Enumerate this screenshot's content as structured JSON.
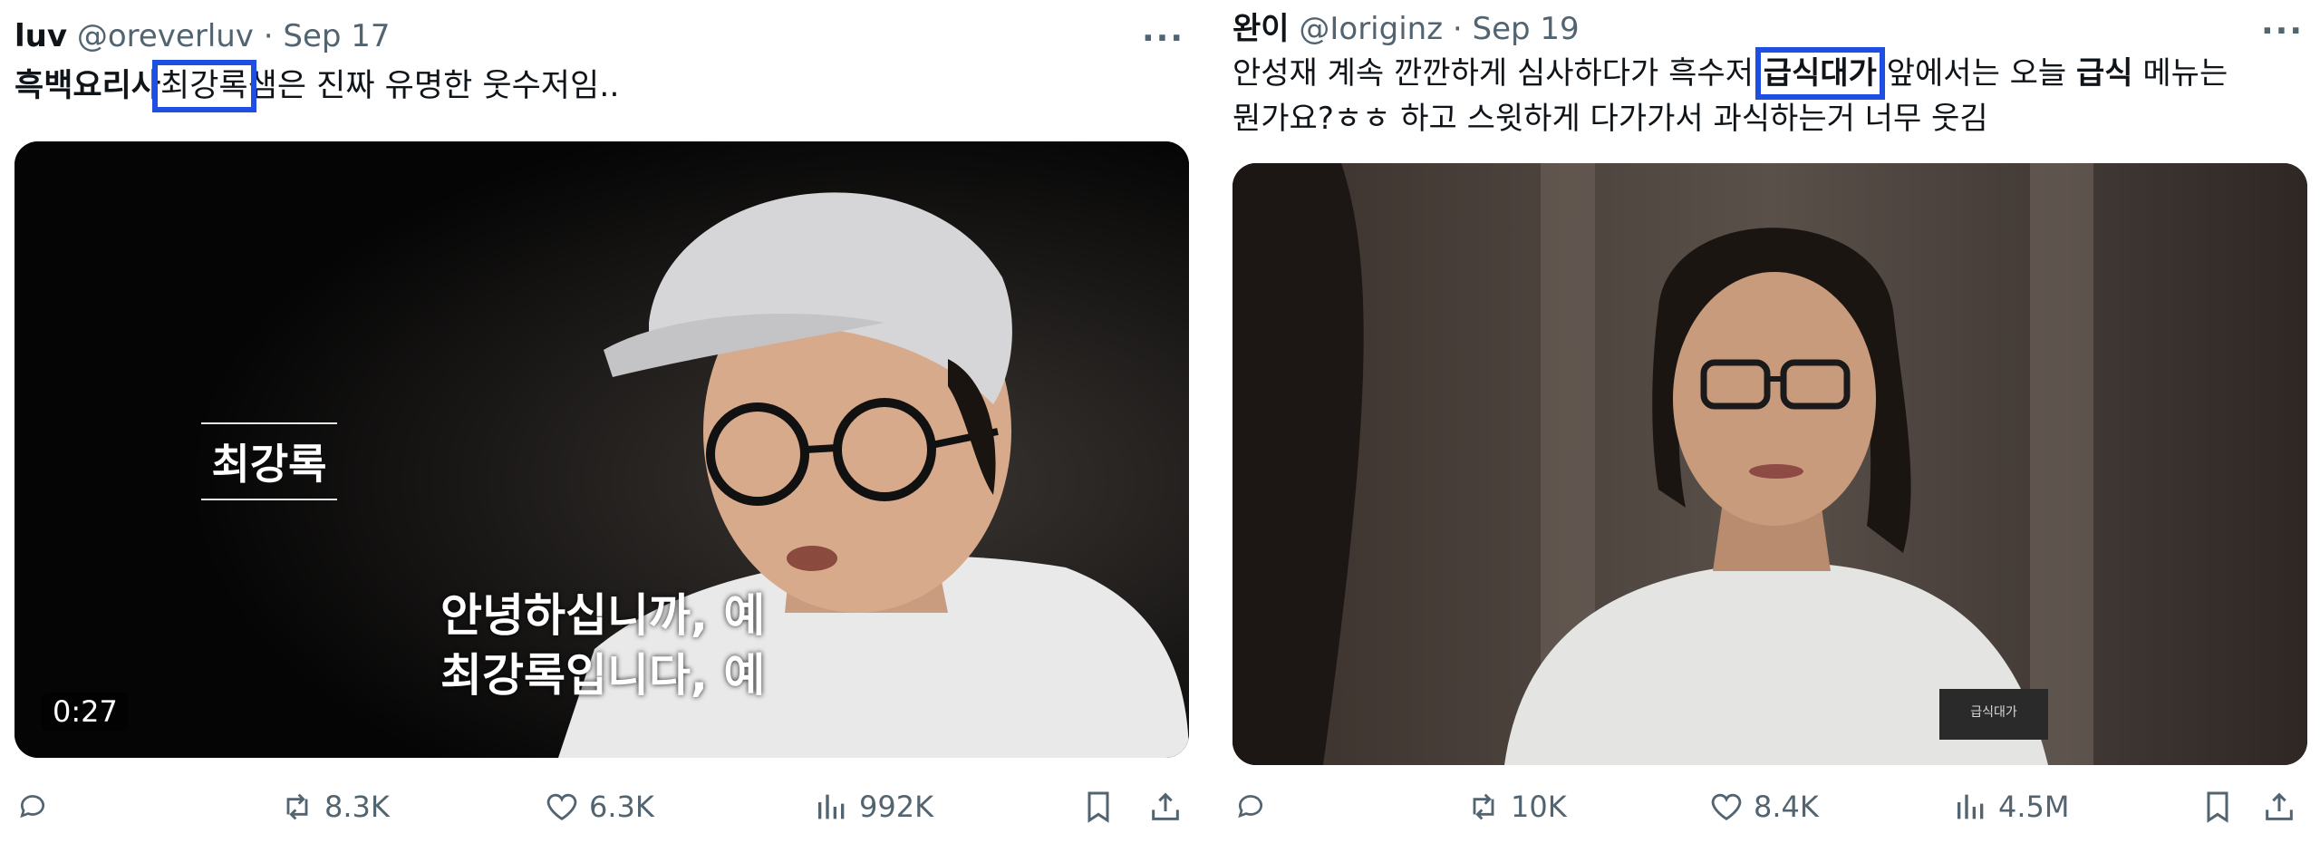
{
  "tweets": [
    {
      "author": {
        "name": "luv",
        "handle": "@oreverluv",
        "date": "Sep 17"
      },
      "more": "···",
      "text": {
        "bold": "흑백요리사",
        "highlight": "최강록",
        "rest": "샘은 진짜 유명한 웃수저임.."
      },
      "media": {
        "duration": "0:27",
        "title_card": "최강록",
        "subtitle": [
          "안녕하십니까, 예",
          "최강록입니다, 예"
        ]
      },
      "actions": {
        "reply": "",
        "retweets": "8.3K",
        "likes": "6.3K",
        "views": "992K"
      }
    },
    {
      "author": {
        "name": "완이",
        "handle": "@Ioriginz",
        "date": "Sep 19"
      },
      "more": "···",
      "text": {
        "line1_a": "안성재 계속 깐깐하게 심사하다가 흑수저 ",
        "line1_highlight": "급식대가",
        "line1_b": " 앞에서는 오늘 ",
        "line1_bold": "급식",
        "line1_c": " 메뉴는",
        "line2": "뭔가요?ㅎㅎ 하고 스윗하게 다가가서 과식하는거 너무 웃김"
      },
      "media": {
        "badge": "급식대가"
      },
      "actions": {
        "reply": "",
        "retweets": "10K",
        "likes": "8.4K",
        "views": "4.5M"
      }
    }
  ],
  "colors": {
    "highlight_box": "#1f4fe0",
    "secondary_text": "#536471"
  },
  "icons": [
    "reply-icon",
    "retweet-icon",
    "like-icon",
    "views-icon",
    "bookmark-icon",
    "share-icon",
    "more-icon"
  ]
}
